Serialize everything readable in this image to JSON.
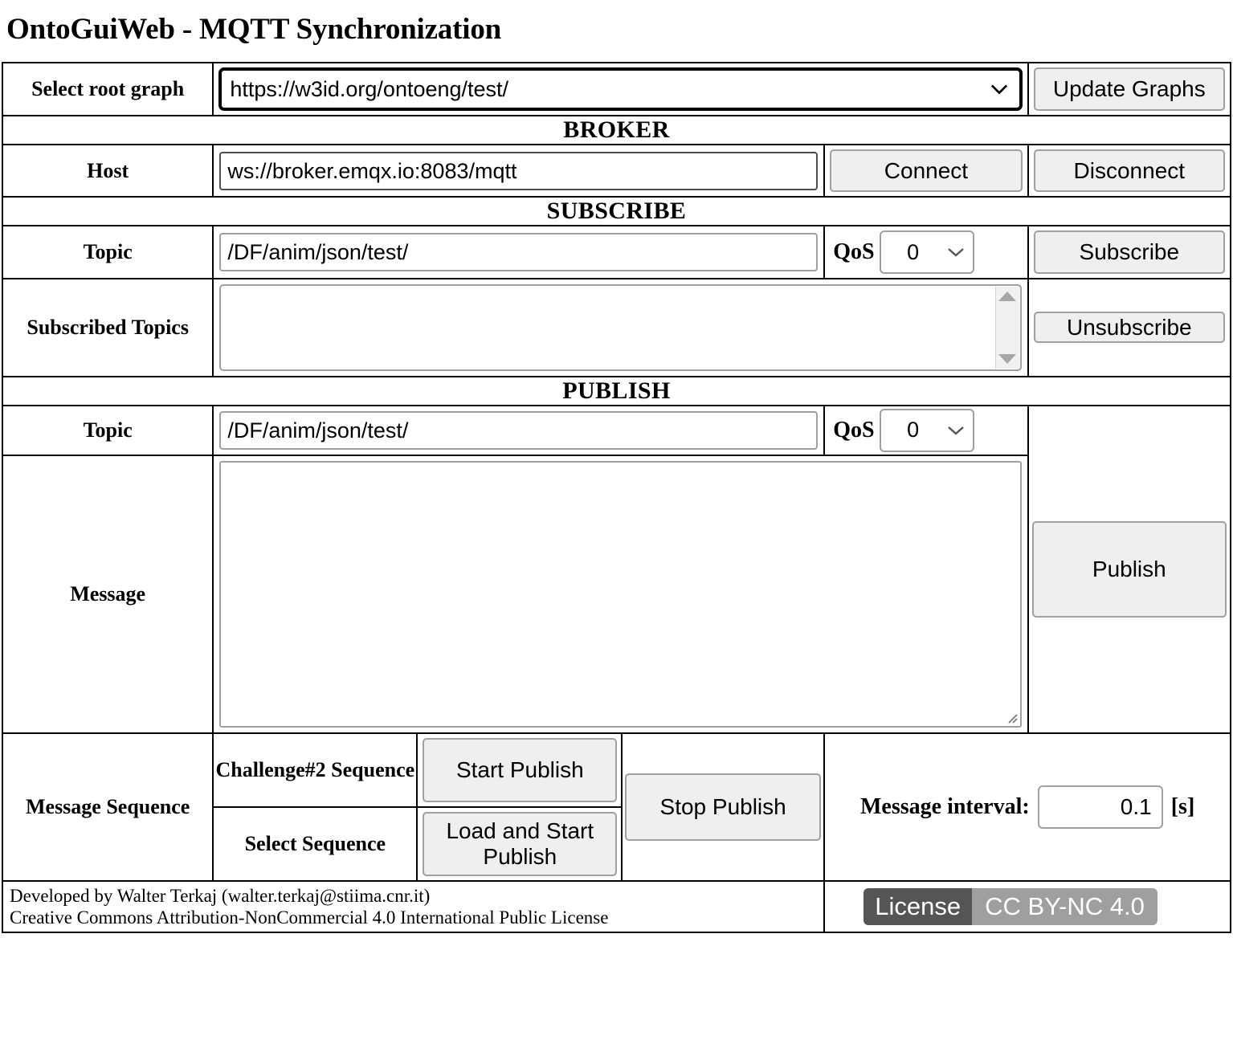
{
  "page": {
    "title": "OntoGuiWeb - MQTT Synchronization"
  },
  "root_graph": {
    "label": "Select root graph",
    "value": "https://w3id.org/ontoeng/test/",
    "caret_icon": "chevron-down-icon",
    "update_button": "Update Graphs"
  },
  "broker": {
    "section_title": "BROKER",
    "host_label": "Host",
    "host_value": "ws://broker.emqx.io:8083/mqtt",
    "connect_button": "Connect",
    "disconnect_button": "Disconnect"
  },
  "subscribe": {
    "section_title": "SUBSCRIBE",
    "topic_label": "Topic",
    "topic_value": "/DF/anim/json/test/",
    "qos_label": "QoS",
    "qos_value": "0",
    "subscribe_button": "Subscribe",
    "subscribed_topics_label": "Subscribed Topics",
    "subscribed_topics_value": "",
    "unsubscribe_button": "Unsubscribe"
  },
  "publish": {
    "section_title": "PUBLISH",
    "topic_label": "Topic",
    "topic_value": "/DF/anim/json/test/",
    "qos_label": "QoS",
    "qos_value": "0",
    "message_label": "Message",
    "message_value": "",
    "publish_button": "Publish"
  },
  "message_sequence": {
    "label": "Message Sequence",
    "challenge_label": "Challenge#2 Sequence",
    "start_publish_button": "Start Publish",
    "select_sequence_label": "Select Sequence",
    "load_and_start_button": "Load and Start Publish",
    "stop_publish_button": "Stop Publish",
    "interval_label": "Message interval:",
    "interval_value": "0.1",
    "interval_unit": "[s]"
  },
  "footer": {
    "line1": "Developed by Walter Terkaj (walter.terkaj@stiima.cnr.it)",
    "line2": "Creative Commons Attribution-NonCommercial 4.0 International Public License",
    "license_label": "License",
    "license_value": "CC BY-NC 4.0"
  },
  "colors": {
    "button_bg": "#efefef",
    "button_border": "#a0a0a0",
    "badge_left": "#555555",
    "badge_right": "#9f9f9f",
    "border": "#000000"
  }
}
